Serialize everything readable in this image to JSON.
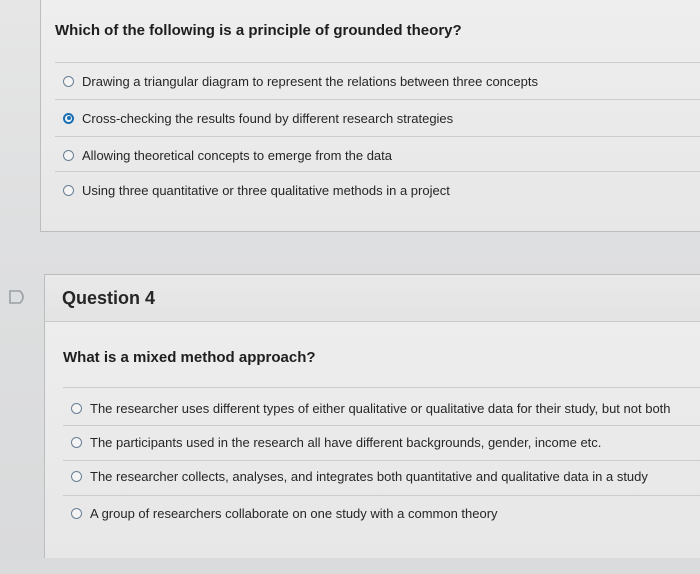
{
  "question3": {
    "text": "Which of the following is a principle of grounded theory?",
    "options": [
      {
        "label": "Drawing a triangular diagram to represent the relations between three concepts",
        "selected": false
      },
      {
        "label": "Cross-checking the results found by different research strategies",
        "selected": true
      },
      {
        "label": "Allowing theoretical concepts to emerge from the data",
        "selected": false
      },
      {
        "label": "Using three quantitative or three qualitative methods in a project",
        "selected": false
      }
    ]
  },
  "question4": {
    "title": "Question 4",
    "text": "What is a mixed method approach?",
    "options": [
      {
        "label": "The researcher uses different types of either qualitative or qualitative data for their study, but not both",
        "selected": false
      },
      {
        "label": "The participants used in the research all have different backgrounds, gender, income etc.",
        "selected": false
      },
      {
        "label": "The researcher collects, analyses, and integrates both quantitative and qualitative data in a study",
        "selected": false
      },
      {
        "label": "A group of researchers collaborate on one study with a common theory",
        "selected": false
      }
    ]
  },
  "colors": {
    "selected_radio": "#1b6fb5",
    "unselected_radio": "#6a7f95",
    "background": "#e4e4e4"
  },
  "icons": {
    "side_tab": "bookmark-flag-icon"
  }
}
